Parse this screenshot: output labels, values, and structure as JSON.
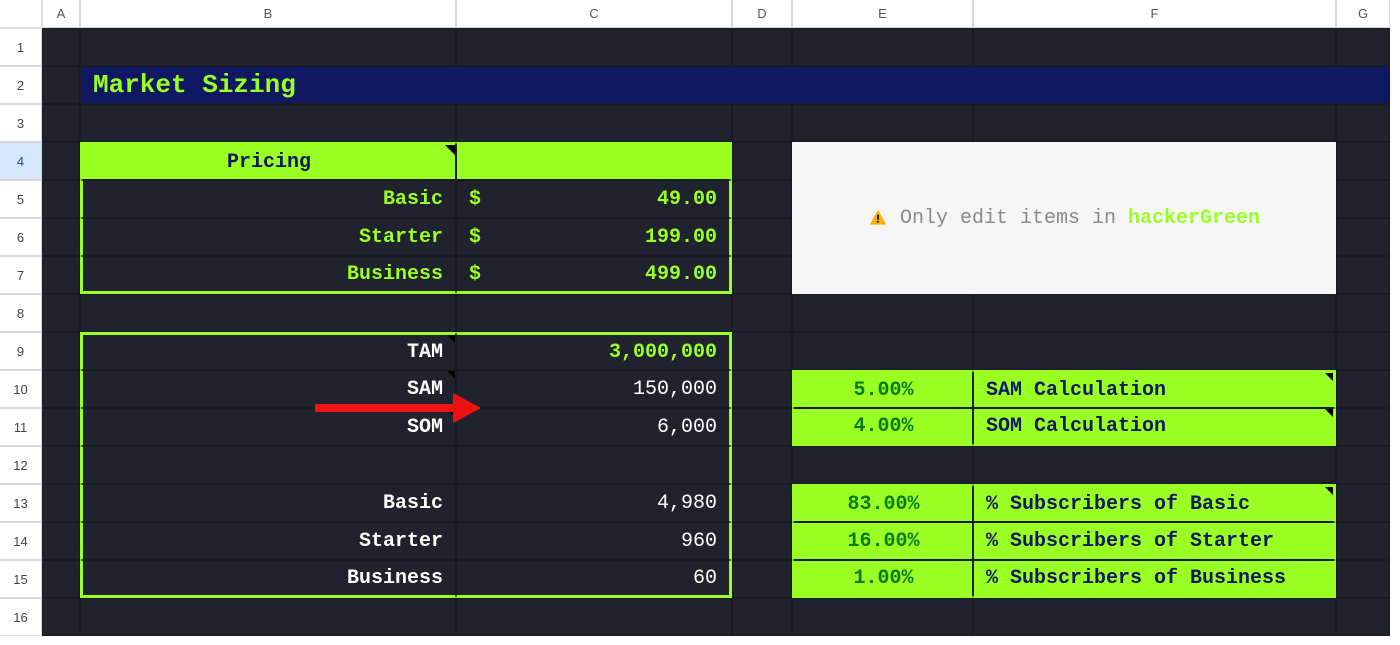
{
  "columns": [
    "A",
    "B",
    "C",
    "D",
    "E",
    "F",
    "G"
  ],
  "rows": [
    "1",
    "2",
    "3",
    "4",
    "5",
    "6",
    "7",
    "8",
    "9",
    "10",
    "11",
    "12",
    "13",
    "14",
    "15",
    "16"
  ],
  "selected_row": "4",
  "title": "Market Sizing",
  "pricing_header": "Pricing",
  "pricing": [
    {
      "label": "Basic",
      "currency": "$",
      "value": "49.00"
    },
    {
      "label": "Starter",
      "currency": "$",
      "value": "199.00"
    },
    {
      "label": "Business",
      "currency": "$",
      "value": "499.00"
    }
  ],
  "market": [
    {
      "label": "TAM",
      "value": "3,000,000",
      "green": true
    },
    {
      "label": "SAM",
      "value": "150,000",
      "green": false
    },
    {
      "label": "SOM",
      "value": "6,000",
      "green": false
    }
  ],
  "subscribers": [
    {
      "label": "Basic",
      "value": "4,980"
    },
    {
      "label": "Starter",
      "value": "960"
    },
    {
      "label": "Business",
      "value": "60"
    }
  ],
  "banner": {
    "prefix": "Only edit items in ",
    "highlight": "hackerGreen"
  },
  "calc_box": [
    {
      "pct": "5.00%",
      "label": "SAM Calculation"
    },
    {
      "pct": "4.00%",
      "label": "SOM Calculation"
    }
  ],
  "subs_box": [
    {
      "pct": "83.00%",
      "label": "% Subscribers of Basic"
    },
    {
      "pct": "16.00%",
      "label": "% Subscribers of Starter"
    },
    {
      "pct": "1.00%",
      "label": "% Subscribers of Business"
    }
  ]
}
